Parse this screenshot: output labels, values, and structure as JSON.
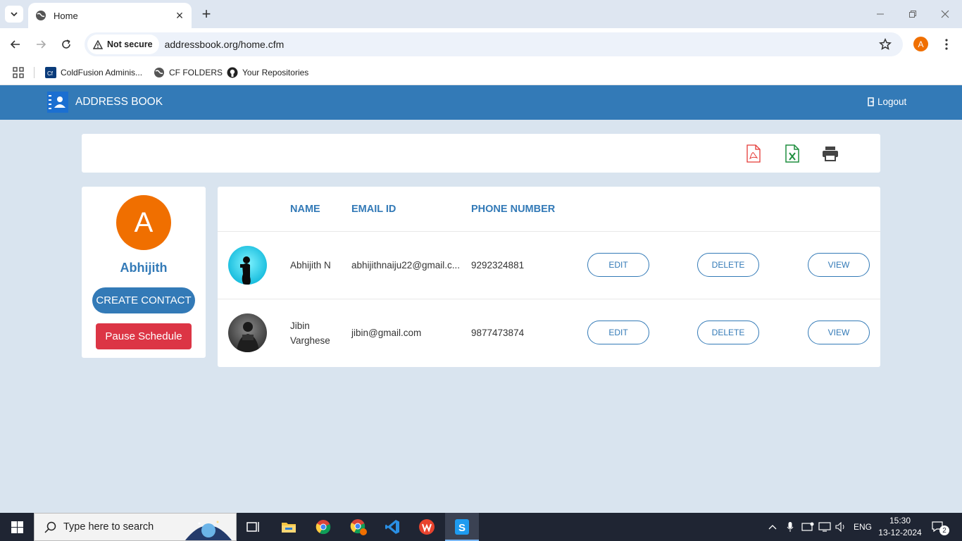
{
  "browser": {
    "tab_title": "Home",
    "security_label": "Not secure",
    "url": "addressbook.org/home.cfm",
    "profile_initial": "A",
    "bookmarks": [
      {
        "label": "ColdFusion Adminis...",
        "icon": "coldfusion-icon"
      },
      {
        "label": "CF FOLDERS",
        "icon": "globe-icon"
      },
      {
        "label": "Your Repositories",
        "icon": "github-icon"
      }
    ]
  },
  "app": {
    "brand": "ADDRESS BOOK",
    "logout_label": "Logout",
    "accent": "#337ab7",
    "export_icons": [
      "pdf-icon",
      "excel-icon",
      "print-icon"
    ]
  },
  "profile": {
    "initial": "A",
    "name": "Abhijith",
    "create_label": "CREATE CONTACT",
    "pause_label": "Pause Schedule"
  },
  "table": {
    "headers": [
      "NAME",
      "EMAIL ID",
      "PHONE NUMBER"
    ],
    "rows": [
      {
        "name": "Abhijith N",
        "email": "abhijithnaiju22@gmail.c...",
        "phone": "9292324881"
      },
      {
        "name": "Jibin Varghese",
        "email": "jibin@gmail.com",
        "phone": "9877473874"
      }
    ],
    "edit_label": "EDIT",
    "delete_label": "DELETE",
    "view_label": "VIEW"
  },
  "taskbar": {
    "search_placeholder": "Type here to search",
    "lang": "ENG",
    "time": "15:30",
    "date": "13-12-2024",
    "notification_count": "2"
  }
}
